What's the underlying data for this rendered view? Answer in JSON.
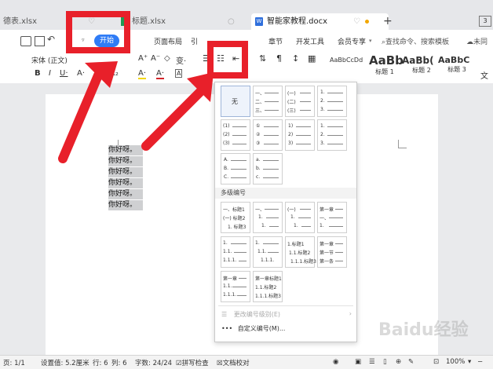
{
  "tabs": [
    {
      "label": "德表.xlsx",
      "close": "♡"
    },
    {
      "label": "标题.xlsx",
      "close": "○"
    },
    {
      "label": "智能家教程.docx",
      "close": "♡"
    }
  ],
  "tab_add": "+",
  "tab_count": "3",
  "menu": {
    "start": "开始",
    "items": [
      "页面布局",
      "引",
      "章节",
      "开发工具",
      "会员专享"
    ],
    "search_placeholder": "查找命令、搜索模板",
    "cloud": "未同"
  },
  "toolbar": {
    "font_name": "宋体 (正文)",
    "font_size_btns": [
      "A⁺",
      "A⁻",
      "◇",
      "变·"
    ],
    "format_btns": [
      "B",
      "I",
      "U·",
      "A·",
      "X²",
      "X₂",
      "A·",
      "A·",
      "A"
    ],
    "styles": [
      {
        "preview": "AaBbCcDd",
        "name": "正文"
      },
      {
        "preview": "AaBb",
        "name": "标题 1"
      },
      {
        "preview": "AaBb(",
        "name": "标题 2"
      },
      {
        "preview": "AaBbC",
        "name": "标题 3"
      }
    ],
    "more": "文"
  },
  "document": {
    "lines": [
      "你好呀。",
      "你好呀。",
      "你好呀。",
      "你好呀。",
      "你好呀。",
      "你好呀。"
    ]
  },
  "dropdown": {
    "none_label": "无",
    "section_title": "多级编号",
    "bullet_cells": [
      [
        "一、",
        "二、",
        "三、"
      ],
      [
        "(一)",
        "(二)",
        "(三)"
      ],
      [
        "1.",
        "2.",
        "3."
      ],
      [
        "(1)",
        "(2)",
        "(3)"
      ],
      [
        "①",
        "②",
        "③"
      ],
      [
        "1)",
        "2)",
        "3)"
      ],
      [
        "1.",
        "2.",
        "3."
      ],
      [
        "A.",
        "B.",
        "C."
      ],
      [
        "a.",
        "b.",
        "c."
      ]
    ],
    "multi_cells": [
      [
        "一、标题1",
        "(一) 标题2",
        "1. 标题3"
      ],
      [
        "一、",
        "1.",
        "1."
      ],
      [
        "(一)",
        "1.",
        "1."
      ],
      [
        "第一章",
        "一、",
        "1."
      ],
      [
        "1.",
        "1.1.",
        "1.1.1."
      ],
      [
        "1.",
        "1.1.",
        "1.1.1."
      ],
      [
        "1.标题1",
        "1.1.标题2",
        "1.1.1.标题3"
      ],
      [
        "第一章",
        "第一节",
        "第一条"
      ],
      [
        "第一章",
        "1.1.",
        "1.1.1."
      ],
      [
        "第一章标题1",
        "1.1.标题2",
        "1.1.1.标题3"
      ]
    ],
    "change_level": "更改编号级别(E)",
    "custom": "自定义编号(M)..."
  },
  "status": {
    "page": "页: 1/1",
    "setting": "设置值: 5.2厘米",
    "row": "行: 6",
    "col": "列: 6",
    "words": "字数: 24/24",
    "spell": "拼写检查",
    "doccheck": "文档校对",
    "zoom": "100%"
  },
  "watermark": "Baidu经验",
  "colors": {
    "accent": "#2f7cf6",
    "annotation": "#e8202a"
  }
}
